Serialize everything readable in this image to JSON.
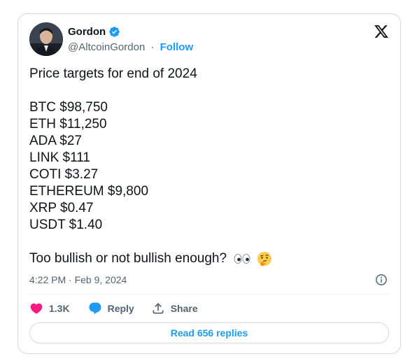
{
  "author": {
    "name": "Gordon",
    "handle": "@AltcoinGordon",
    "separator": "·",
    "follow_label": "Follow"
  },
  "tweet": {
    "intro": "Price targets for end of 2024",
    "lines": [
      "BTC $98,750",
      "ETH $11,250",
      "ADA $27",
      "LINK $111",
      "COTI $3.27",
      "ETHEREUM $9,800",
      "XRP $0.47",
      "USDT $1.40"
    ],
    "outro": "Too bullish or not bullish enough?",
    "emojis": [
      "eyes-emoji",
      "thinking-face-emoji"
    ]
  },
  "timestamp": "4:22 PM · Feb 9, 2024",
  "actions": {
    "like_count": "1.3K",
    "reply_label": "Reply",
    "share_label": "Share"
  },
  "read_replies_label": "Read 656 replies",
  "colors": {
    "accent": "#1d9bf0",
    "like": "#f91880",
    "text": "#0f1419",
    "muted": "#536471",
    "border": "#cfd9de"
  }
}
